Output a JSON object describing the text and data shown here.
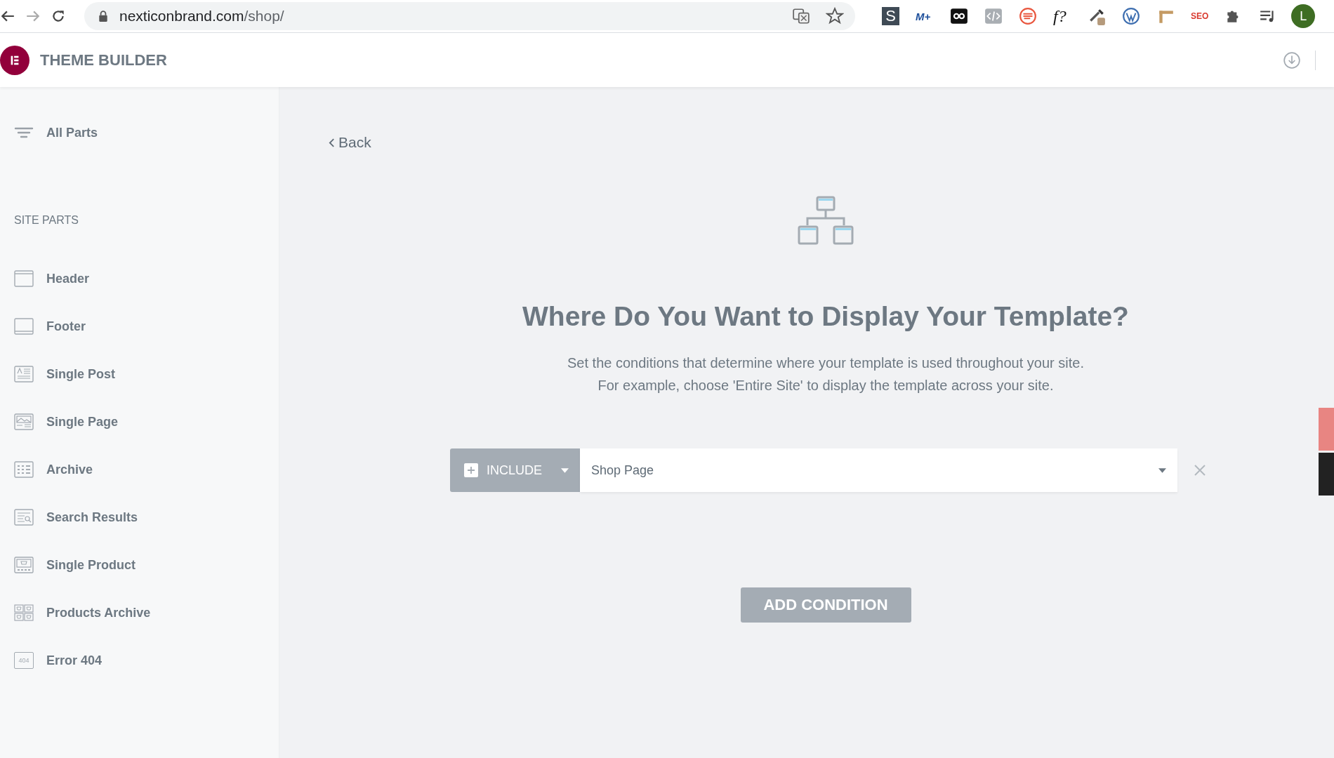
{
  "browser": {
    "url_host": "nexticonbrand.com",
    "url_path": "/shop/",
    "extensions": [
      {
        "kind": "translate"
      },
      {
        "kind": "star"
      },
      {
        "kind": "letter-box",
        "label": "S"
      },
      {
        "kind": "mplus",
        "label": "M+"
      },
      {
        "kind": "infinity"
      },
      {
        "kind": "code"
      },
      {
        "kind": "lines-circle"
      },
      {
        "kind": "italic",
        "label": "f?"
      },
      {
        "kind": "dropper"
      },
      {
        "kind": "wp"
      },
      {
        "kind": "ruler"
      },
      {
        "kind": "seo",
        "label": "SEO"
      },
      {
        "kind": "puzzle"
      },
      {
        "kind": "playlist"
      },
      {
        "kind": "avatar",
        "label": "L"
      }
    ]
  },
  "app_header": {
    "title": "THEME BUILDER"
  },
  "sidebar": {
    "all_parts": "All Parts",
    "section_title": "SITE PARTS",
    "items": [
      {
        "kind": "header",
        "label": "Header"
      },
      {
        "kind": "footer",
        "label": "Footer"
      },
      {
        "kind": "post",
        "label": "Single Post"
      },
      {
        "kind": "page",
        "label": "Single Page"
      },
      {
        "kind": "archive",
        "label": "Archive"
      },
      {
        "kind": "search",
        "label": "Search Results"
      },
      {
        "kind": "product",
        "label": "Single Product"
      },
      {
        "kind": "products",
        "label": "Products Archive"
      },
      {
        "kind": "error",
        "label": "Error 404",
        "icon_text": "404"
      }
    ]
  },
  "main": {
    "back": "Back",
    "title": "Where Do You Want to Display Your Template?",
    "description": [
      "Set the conditions that determine where your template is used throughout your site.",
      "For example, choose 'Entire Site' to display the template across your site."
    ],
    "conditions": [
      {
        "type": "INCLUDE",
        "value": "Shop Page"
      }
    ],
    "add_button": "ADD CONDITION"
  },
  "side_tabs": [
    {
      "color": "#e88582"
    },
    {
      "color": "#222222"
    }
  ]
}
